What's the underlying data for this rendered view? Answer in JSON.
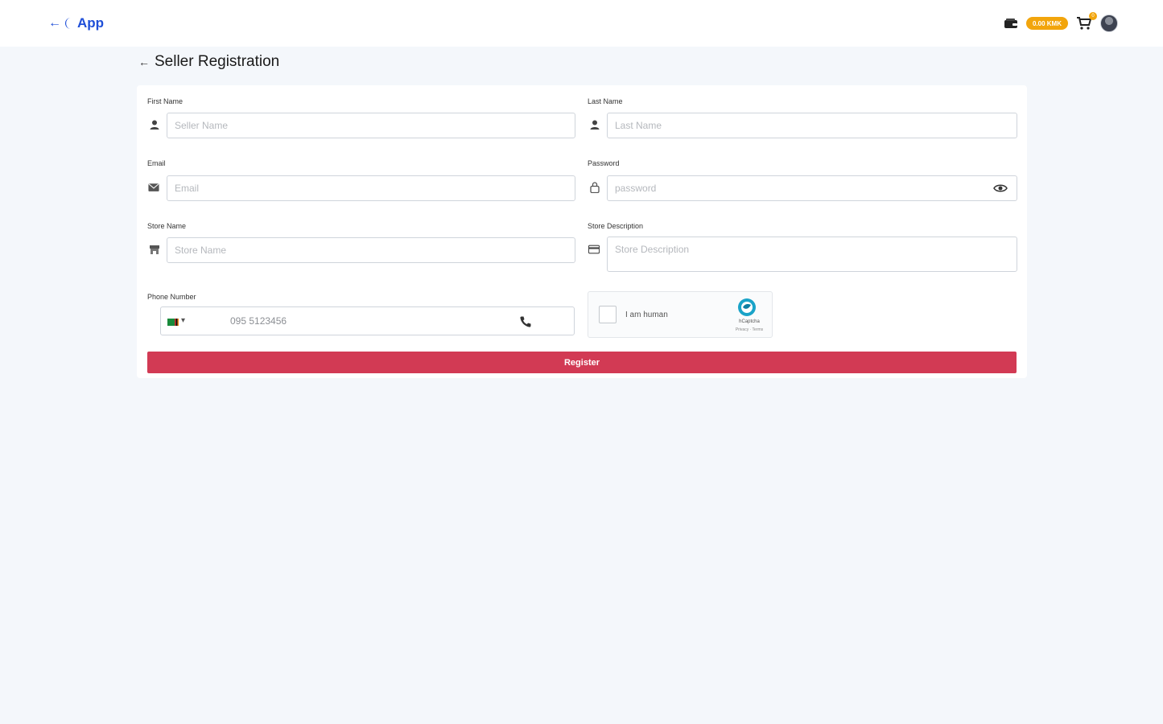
{
  "header": {
    "back_arrow": "←",
    "app_name": "App",
    "balance": "0.00 KMK",
    "cart_count": "0",
    "colors": {
      "brand": "#1f4fd8",
      "badge": "#f2a50c"
    }
  },
  "page": {
    "title": "Seller Registration",
    "back_arrow": "←"
  },
  "form": {
    "first_name": {
      "label": "First Name",
      "placeholder": "Seller Name",
      "icon": "person-icon"
    },
    "last_name": {
      "label": "Last Name",
      "placeholder": "Last Name",
      "icon": "person-icon"
    },
    "email": {
      "label": "Email",
      "placeholder": "Email",
      "icon": "envelope-icon"
    },
    "password": {
      "label": "Password",
      "placeholder": "password",
      "icon": "lock-icon"
    },
    "store_name": {
      "label": "Store Name",
      "placeholder": "Store Name",
      "icon": "store-icon"
    },
    "store_description": {
      "label": "Store Description",
      "placeholder": "Store Description",
      "icon": "card-icon"
    },
    "phone": {
      "label": "Phone Number",
      "value": "095 5123456",
      "flag": "zambia-flag-icon"
    },
    "captcha": {
      "label": "I am human",
      "brand": "hCaptcha",
      "links": "Privacy · Terms"
    },
    "submit_label": "Register",
    "colors": {
      "submit": "#d23a54"
    }
  }
}
